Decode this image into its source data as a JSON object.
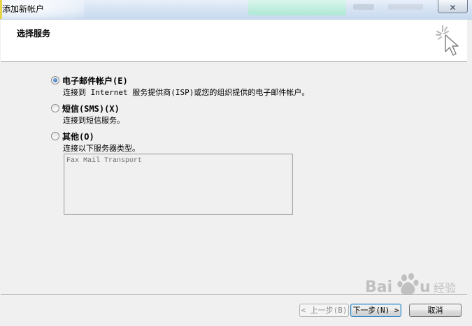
{
  "window": {
    "title": "添加新帐户",
    "close_glyph": "✕"
  },
  "header": {
    "title": "选择服务",
    "icon": "wizard-cursor-icon"
  },
  "options": [
    {
      "label": "电子邮件帐户(E)",
      "description": "连接到 Internet 服务提供商(ISP)或您的组织提供的电子邮件帐户。",
      "selected": true
    },
    {
      "label": "短信(SMS)(X)",
      "description": "连接到短信服务。",
      "selected": false
    },
    {
      "label": "其他(O)",
      "description": "连接以下服务器类型。",
      "selected": false
    }
  ],
  "service_list": {
    "items": [
      "Fax Mail Transport"
    ],
    "enabled": false
  },
  "buttons": {
    "back_label": "< 上一步(B)",
    "next_label": "下一步(N) >",
    "cancel_label": "取消"
  },
  "watermark": {
    "text": "Baidu 经验"
  },
  "colors": {
    "radio_checked": "#1c5aa3",
    "default_button_border": "#3c7fb1"
  }
}
